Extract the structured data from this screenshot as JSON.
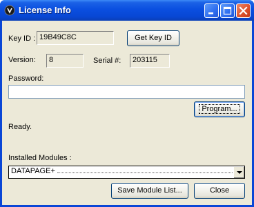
{
  "window": {
    "title": "License Info",
    "controls": {
      "minimize": "_",
      "maximize": "□",
      "close": "×"
    }
  },
  "key_id": {
    "label": "Key ID :",
    "value": "19B49C8C",
    "button": "Get Key ID"
  },
  "version": {
    "label": "Version:",
    "value": "8"
  },
  "serial": {
    "label": "Serial #:",
    "value": "203115"
  },
  "password": {
    "label": "Password:",
    "value": "",
    "program_button": "Program..."
  },
  "status": {
    "text": "Ready."
  },
  "modules": {
    "label": "Installed Modules :",
    "selected": "DATAPAGE+"
  },
  "footer": {
    "save_button": "Save Module List...",
    "close_button": "Close"
  },
  "colors": {
    "title_bar": "#0a4fe0",
    "dialog_bg": "#ece9d8",
    "close_btn": "#dc4f2a"
  }
}
